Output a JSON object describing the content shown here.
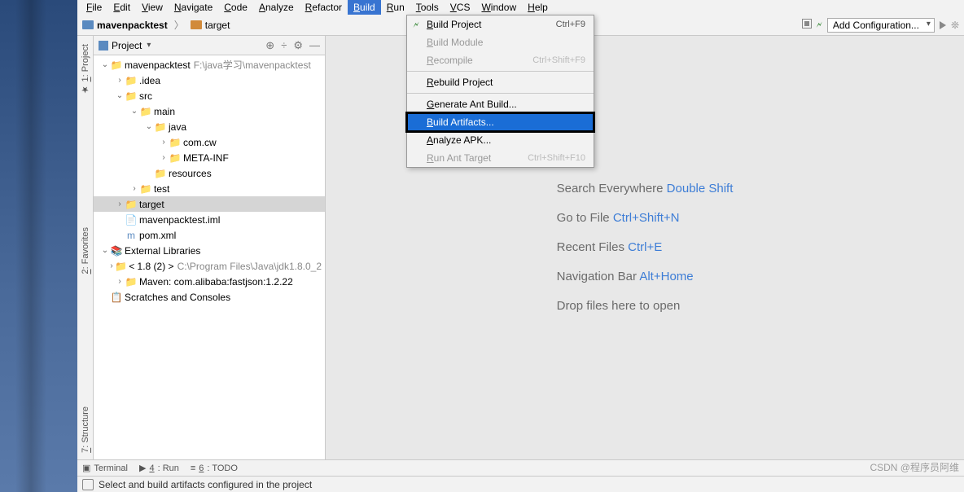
{
  "menubar": [
    "File",
    "Edit",
    "View",
    "Navigate",
    "Code",
    "Analyze",
    "Refactor",
    "Build",
    "Run",
    "Tools",
    "VCS",
    "Window",
    "Help"
  ],
  "menubar_active_index": 7,
  "breadcrumb": {
    "root": "mavenpacktest",
    "child": "target"
  },
  "toolbar": {
    "add_config": "Add Configuration..."
  },
  "dropdown": {
    "items": [
      {
        "label": "Build Project",
        "shortcut": "Ctrl+F9",
        "icon": "hammer"
      },
      {
        "label": "Build Module",
        "disabled": true
      },
      {
        "label": "Recompile",
        "shortcut": "Ctrl+Shift+F9",
        "disabled": true
      },
      {
        "sep": true
      },
      {
        "label": "Rebuild Project"
      },
      {
        "sep": true
      },
      {
        "label": "Generate Ant Build..."
      },
      {
        "label": "Build Artifacts...",
        "highlight": true
      },
      {
        "label": "Analyze APK..."
      },
      {
        "label": "Run Ant Target",
        "shortcut": "Ctrl+Shift+F10",
        "disabled": true
      }
    ]
  },
  "left_rail": [
    "1: Project",
    "2: Favorites",
    "7: Structure"
  ],
  "panel": {
    "title": "Project"
  },
  "tree": [
    {
      "d": 0,
      "chev": "v",
      "icon": "📁",
      "cls": "folder-b",
      "label": "mavenpacktest",
      "path": "F:\\java学习\\mavenpacktest"
    },
    {
      "d": 1,
      "chev": ">",
      "icon": "📁",
      "cls": "folder-g",
      "label": ".idea"
    },
    {
      "d": 1,
      "chev": "v",
      "icon": "📁",
      "cls": "folder-g",
      "label": "src"
    },
    {
      "d": 2,
      "chev": "v",
      "icon": "📁",
      "cls": "folder-g",
      "label": "main"
    },
    {
      "d": 3,
      "chev": "v",
      "icon": "📁",
      "cls": "folder-b",
      "label": "java"
    },
    {
      "d": 4,
      "chev": ">",
      "icon": "📁",
      "cls": "folder-g",
      "label": "com.cw"
    },
    {
      "d": 4,
      "chev": ">",
      "icon": "📁",
      "cls": "folder-g",
      "label": "META-INF"
    },
    {
      "d": 3,
      "chev": "",
      "icon": "📁",
      "cls": "folder-y",
      "label": "resources"
    },
    {
      "d": 2,
      "chev": ">",
      "icon": "📁",
      "cls": "folder-g",
      "label": "test"
    },
    {
      "d": 1,
      "chev": ">",
      "icon": "📁",
      "cls": "folder-o",
      "label": "target",
      "selected": true
    },
    {
      "d": 1,
      "chev": "",
      "icon": "📄",
      "cls": "",
      "label": "mavenpacktest.iml"
    },
    {
      "d": 1,
      "chev": "",
      "icon": "m",
      "cls": "folder-b",
      "label": "pom.xml"
    },
    {
      "d": 0,
      "chev": "v",
      "icon": "📚",
      "cls": "folder-o",
      "label": "External Libraries"
    },
    {
      "d": 1,
      "chev": ">",
      "icon": "📁",
      "cls": "folder-b",
      "label": "< 1.8 (2) >",
      "path": "C:\\Program Files\\Java\\jdk1.8.0_2"
    },
    {
      "d": 1,
      "chev": ">",
      "icon": "📁",
      "cls": "folder-b",
      "label": "Maven: com.alibaba:fastjson:1.2.22"
    },
    {
      "d": 0,
      "chev": "",
      "icon": "📋",
      "cls": "folder-y",
      "label": "Scratches and Consoles"
    }
  ],
  "welcome": [
    {
      "text": "Search Everywhere ",
      "key": "Double Shift"
    },
    {
      "text": "Go to File ",
      "key": "Ctrl+Shift+N"
    },
    {
      "text": "Recent Files ",
      "key": "Ctrl+E"
    },
    {
      "text": "Navigation Bar ",
      "key": "Alt+Home"
    },
    {
      "text": "Drop files here to open",
      "key": ""
    }
  ],
  "bottom_tabs": [
    "Terminal",
    "4: Run",
    "6: TODO"
  ],
  "status": "Select and build artifacts configured in the project",
  "watermark": "CSDN @程序员阿维"
}
